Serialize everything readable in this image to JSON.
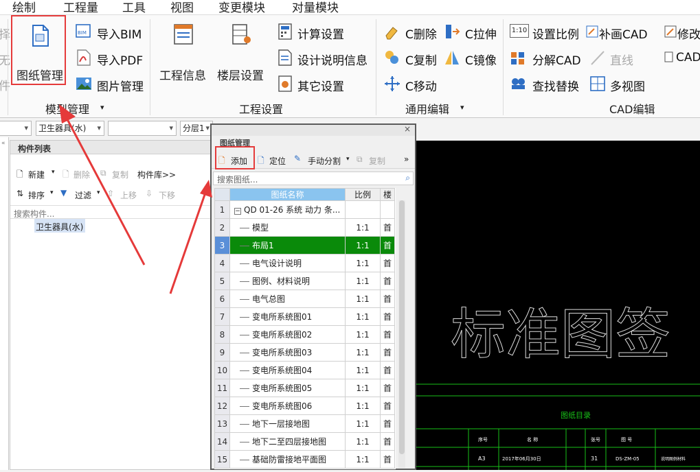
{
  "menu": {
    "items": [
      "绘制",
      "工程量",
      "工具",
      "视图",
      "变更模块",
      "对量模块"
    ]
  },
  "ribbon": {
    "model": {
      "drawing_mgr": "图纸管理",
      "import_bim": "导入BIM",
      "import_pdf": "导入PDF",
      "image_mgr": "图片管理",
      "group": "模型管理"
    },
    "project": {
      "info": "工程信息",
      "floor": "楼层设置",
      "calc": "计算设置",
      "design_desc": "设计说明信息",
      "other": "其它设置",
      "group": "工程设置"
    },
    "edit": {
      "delete": "C删除",
      "stretch": "C拉伸",
      "copy": "C复制",
      "mirror": "C镜像",
      "move": "C移动",
      "group": "通用编辑"
    },
    "cad": {
      "scale_icon": "1:10",
      "set_scale": "设置比例",
      "redraw": "补画CAD",
      "modify": "修改",
      "explode": "分解CAD",
      "line": "直线",
      "cad2": "CAD",
      "find_replace": "查找替换",
      "multi_view": "多视图",
      "group": "CAD编辑"
    }
  },
  "left_cut": {
    "a": "择",
    "b": "无",
    "c": "件"
  },
  "combos": {
    "c2": "卫生器具(水)",
    "c4": "分层1"
  },
  "complist": {
    "title": "构件列表",
    "new": "新建",
    "delete": "删除",
    "copy": "复制",
    "library": "构件库>>",
    "sort": "排序",
    "filter": "过滤",
    "up": "上移",
    "down": "下移",
    "search_placeholder": "搜索构件...",
    "tree_item": "卫生器具(水)"
  },
  "dialog": {
    "title": "图纸管理",
    "add": "添加",
    "locate": "定位",
    "split": "手动分割",
    "copy": "复制",
    "more": "»",
    "search_placeholder": "搜索图纸...",
    "headers": {
      "name": "图纸名称",
      "scale": "比例",
      "page": "楼"
    },
    "rows": [
      {
        "no": "1",
        "name": "QD 01-26 系统 动力 条...",
        "scale": "",
        "page": ""
      },
      {
        "no": "2",
        "name": "模型",
        "scale": "1:1",
        "page": "首"
      },
      {
        "no": "3",
        "name": "布局1",
        "scale": "1:1",
        "page": "首"
      },
      {
        "no": "4",
        "name": "电气设计说明",
        "scale": "1:1",
        "page": "首"
      },
      {
        "no": "5",
        "name": "图例、材料说明",
        "scale": "1:1",
        "page": "首"
      },
      {
        "no": "6",
        "name": "电气总图",
        "scale": "1:1",
        "page": "首"
      },
      {
        "no": "7",
        "name": "变电所系统图01",
        "scale": "1:1",
        "page": "首"
      },
      {
        "no": "8",
        "name": "变电所系统图02",
        "scale": "1:1",
        "page": "首"
      },
      {
        "no": "9",
        "name": "变电所系统图03",
        "scale": "1:1",
        "page": "首"
      },
      {
        "no": "10",
        "name": "变电所系统图04",
        "scale": "1:1",
        "page": "首"
      },
      {
        "no": "11",
        "name": "变电所系统图05",
        "scale": "1:1",
        "page": "首"
      },
      {
        "no": "12",
        "name": "变电所系统图06",
        "scale": "1:1",
        "page": "首"
      },
      {
        "no": "13",
        "name": "地下一层接地图",
        "scale": "1:1",
        "page": "首"
      },
      {
        "no": "14",
        "name": "地下二至四层接地图",
        "scale": "1:1",
        "page": "首"
      },
      {
        "no": "15",
        "name": "基础防雷接地平面图",
        "scale": "1:1",
        "page": "首"
      }
    ],
    "selected_index": 2
  },
  "cad": {
    "stamp_text": "标准图签",
    "catalog_title": "图纸目录",
    "cells": [
      "序号",
      "名  称",
      "张号",
      "图  号"
    ],
    "row": [
      "A3",
      "2017年06月30日",
      "31",
      "DS-ZM-05",
      "说明图例材料"
    ]
  },
  "colors": {
    "selected_row": "#0a8a0a",
    "highlight": "#e53a3a",
    "cad_line": "#18c018"
  }
}
